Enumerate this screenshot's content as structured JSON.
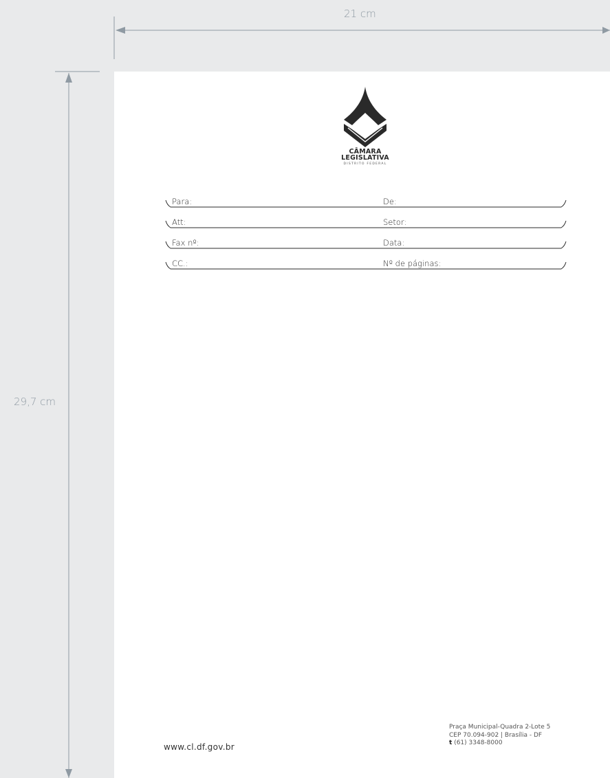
{
  "dimensions": {
    "width": "21 cm",
    "height": "29,7 cm"
  },
  "logo": {
    "line1": "CÂMARA",
    "line2": "LEGISLATIVA",
    "line3": "DISTRITO FEDERAL"
  },
  "fields": [
    {
      "left": "Para:",
      "right": "De:"
    },
    {
      "left": "Att:",
      "right": "Setor:"
    },
    {
      "left": "Fax nº:",
      "right": "Data:"
    },
    {
      "left": "CC.:",
      "right": "Nº de páginas:"
    }
  ],
  "footer": {
    "website": "www.cl.df.gov.br",
    "address_line1": "Praça Municipal-Quadra 2-Lote 5",
    "address_line2": "CEP 70.094-902 | Brasília - DF",
    "phone_prefix": "t",
    "phone": "(61) 3348-8000"
  },
  "colors": {
    "background": "#e9eaeb",
    "dimension_lines": "#8f9aa3",
    "sheet": "#ffffff",
    "ink": "#2a2a2a"
  }
}
